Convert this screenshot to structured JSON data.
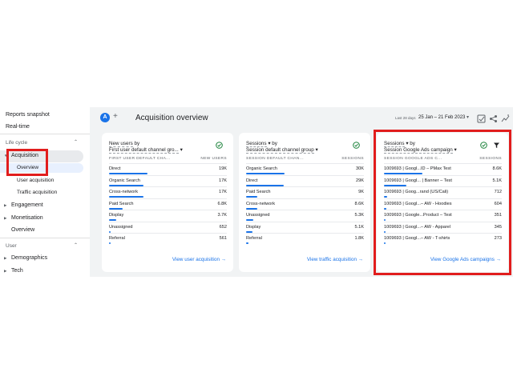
{
  "sidebar": {
    "reports_snapshot": "Reports snapshot",
    "realtime": "Real-time",
    "lifecycle_section": "Life cycle",
    "acquisition": "Acquisition",
    "overview": "Overview",
    "user_acquisition": "User acquisition",
    "traffic_acquisition": "Traffic acquisition",
    "engagement": "Engagement",
    "monetisation": "Monetisation",
    "overview2": "Overview",
    "user_section": "User",
    "demographics": "Demographics",
    "tech": "Tech"
  },
  "header": {
    "avatar": "A",
    "plus": "+",
    "title": "Acquisition overview",
    "range_label": "Last 28 days",
    "range": "25 Jan – 21 Feb 2023",
    "caret": "▾",
    "icons": [
      "compare-icon",
      "share-icon",
      "insights-icon"
    ]
  },
  "cards": [
    {
      "title_metric": "New users",
      "title_by": " by",
      "title_dim": "First user default channel gro...",
      "col_dim": "FIRST USER DEFAULT CHA...",
      "col_metric": "NEW USERS",
      "rows": [
        {
          "label": "Direct",
          "value": "19K",
          "fraction": 1.0
        },
        {
          "label": "Organic Search",
          "value": "17K",
          "fraction": 0.89
        },
        {
          "label": "Cross-network",
          "value": "17K",
          "fraction": 0.89
        },
        {
          "label": "Paid Search",
          "value": "6.8K",
          "fraction": 0.36
        },
        {
          "label": "Display",
          "value": "3.7K",
          "fraction": 0.19
        },
        {
          "label": "Unassigned",
          "value": "652",
          "fraction": 0.04
        },
        {
          "label": "Referral",
          "value": "561",
          "fraction": 0.03
        }
      ],
      "link": "View user acquisition →"
    },
    {
      "title_metric": "Sessions",
      "title_by": " by",
      "title_dim": "Session default channel group",
      "col_dim": "SESSION DEFAULT CHAN...",
      "col_metric": "SESSIONS",
      "rows": [
        {
          "label": "Organic Search",
          "value": "30K",
          "fraction": 1.0
        },
        {
          "label": "Direct",
          "value": "29K",
          "fraction": 0.97
        },
        {
          "label": "Paid Search",
          "value": "9K",
          "fraction": 0.3
        },
        {
          "label": "Cross-network",
          "value": "8.6K",
          "fraction": 0.29
        },
        {
          "label": "Unassigned",
          "value": "5.3K",
          "fraction": 0.18
        },
        {
          "label": "Display",
          "value": "5.1K",
          "fraction": 0.17
        },
        {
          "label": "Referral",
          "value": "1.8K",
          "fraction": 0.06
        }
      ],
      "link": "View traffic acquisition →"
    },
    {
      "title_metric": "Sessions",
      "title_by": " by",
      "title_dim": "Session Google Ads campaign",
      "col_dim": "SESSION GOOGLE ADS C...",
      "col_metric": "SESSIONS",
      "rows": [
        {
          "label": "1009693 | Googl...ID – PMax Test",
          "value": "8.6K",
          "fraction": 1.0
        },
        {
          "label": "1009693 | Googl... | Banner – Test",
          "value": "5.1K",
          "fraction": 0.59
        },
        {
          "label": "1009693 | Goog...rand (US/Cali)",
          "value": "712",
          "fraction": 0.08
        },
        {
          "label": "1009693 | Googl...– AW - Hoodies",
          "value": "604",
          "fraction": 0.07
        },
        {
          "label": "1009693 | Google...Product – Test",
          "value": "351",
          "fraction": 0.04
        },
        {
          "label": "1009693 | Googl...– AW - Apparel",
          "value": "345",
          "fraction": 0.04
        },
        {
          "label": "1009693 | Googl...– AW - T-shirts",
          "value": "273",
          "fraction": 0.03
        }
      ],
      "link": "View Google Ads campaigns →"
    }
  ],
  "highlight_color": "#e11d1d",
  "accent_color": "#1a73e8"
}
